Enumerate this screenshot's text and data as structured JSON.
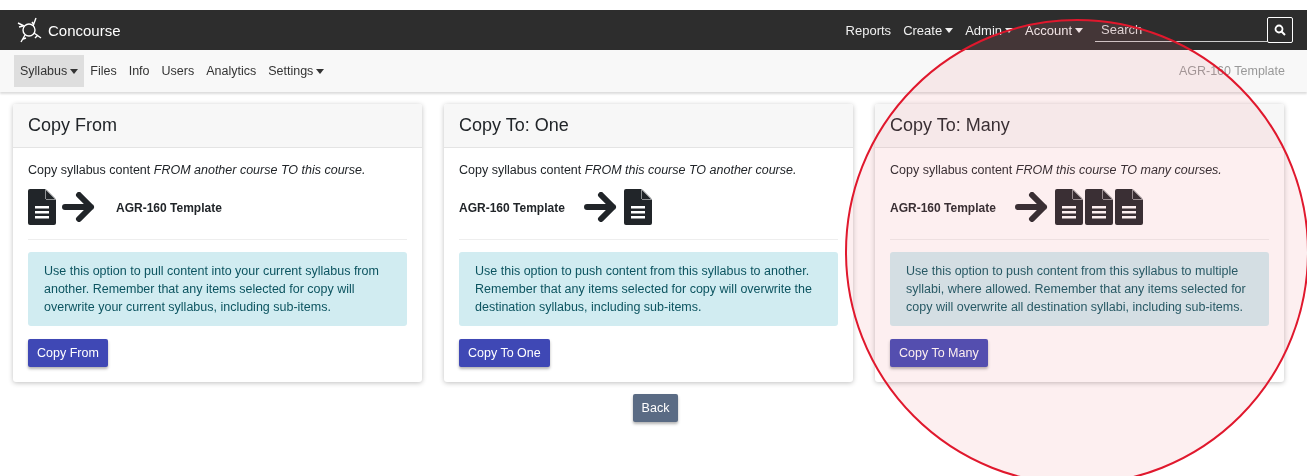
{
  "topbar": {
    "brand": "Concourse",
    "menu": [
      {
        "label": "Reports",
        "dropdown": false
      },
      {
        "label": "Create",
        "dropdown": true
      },
      {
        "label": "Admin",
        "dropdown": true
      },
      {
        "label": "Account",
        "dropdown": true
      }
    ],
    "search": {
      "placeholder": "Search"
    }
  },
  "subnav": {
    "items": [
      {
        "label": "Syllabus",
        "dropdown": true,
        "selected": true
      },
      {
        "label": "Files",
        "dropdown": false,
        "selected": false
      },
      {
        "label": "Info",
        "dropdown": false,
        "selected": false
      },
      {
        "label": "Users",
        "dropdown": false,
        "selected": false
      },
      {
        "label": "Analytics",
        "dropdown": false,
        "selected": false
      },
      {
        "label": "Settings",
        "dropdown": true,
        "selected": false
      }
    ],
    "course": "AGR-160 Template"
  },
  "cards": [
    {
      "title": "Copy From",
      "intro": "Copy syllabus content *FROM another course TO this course.*",
      "kind": "pull",
      "course": "AGR-160 Template",
      "note": "Use this option to pull content into your current syllabus from another. Remember that any items selected for copy will overwrite your current syllabus, including sub-items.",
      "button": "Copy From"
    },
    {
      "title": "Copy To: One",
      "intro": "Copy syllabus content *FROM this course TO another course.*",
      "kind": "push-one",
      "course": "AGR-160 Template",
      "note": "Use this option to push content from this syllabus to another. Remember that any items selected for copy will overwrite the destination syllabus, including sub-items.",
      "button": "Copy To One"
    },
    {
      "title": "Copy To: Many",
      "intro": "Copy syllabus content *FROM this course TO many courses.*",
      "kind": "push-many",
      "course": "AGR-160 Template",
      "note": "Use this option to push content from this syllabus to multiple syllabi, where allowed. Remember that any items selected for copy will overwrite all destination syllabi, including sub-items.",
      "button": "Copy To Many"
    }
  ],
  "back_button": "Back"
}
